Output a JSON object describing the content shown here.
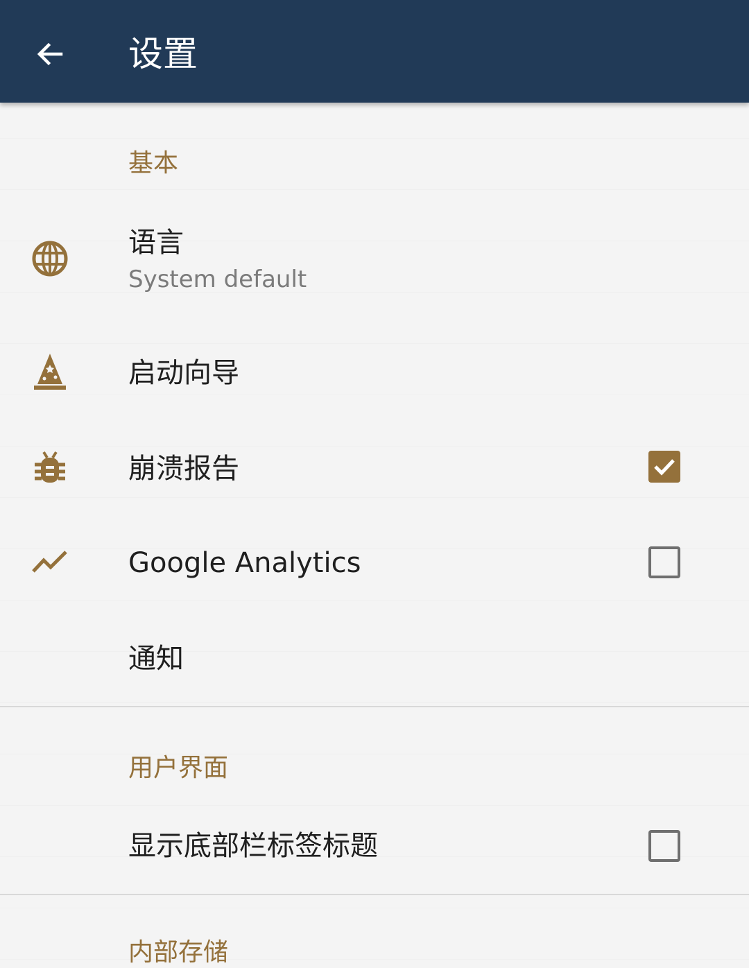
{
  "appbar": {
    "title": "设置",
    "back_icon": "arrow-left-icon",
    "background": "#213a57"
  },
  "accent_color": "#94713b",
  "sections": [
    {
      "header": "基本",
      "items": [
        {
          "icon": "globe-icon",
          "label": "语言",
          "summary": "System default"
        },
        {
          "icon": "wizard-hat-icon",
          "label": "启动向导"
        },
        {
          "icon": "bug-icon",
          "label": "崩溃报告",
          "checked": true
        },
        {
          "icon": "trending-up-icon",
          "label": "Google Analytics",
          "checked": false
        },
        {
          "label": "通知"
        }
      ]
    },
    {
      "header": "用户界面",
      "items": [
        {
          "label": "显示底部栏标签标题",
          "checked": false
        }
      ]
    },
    {
      "header": "内部存储"
    }
  ]
}
